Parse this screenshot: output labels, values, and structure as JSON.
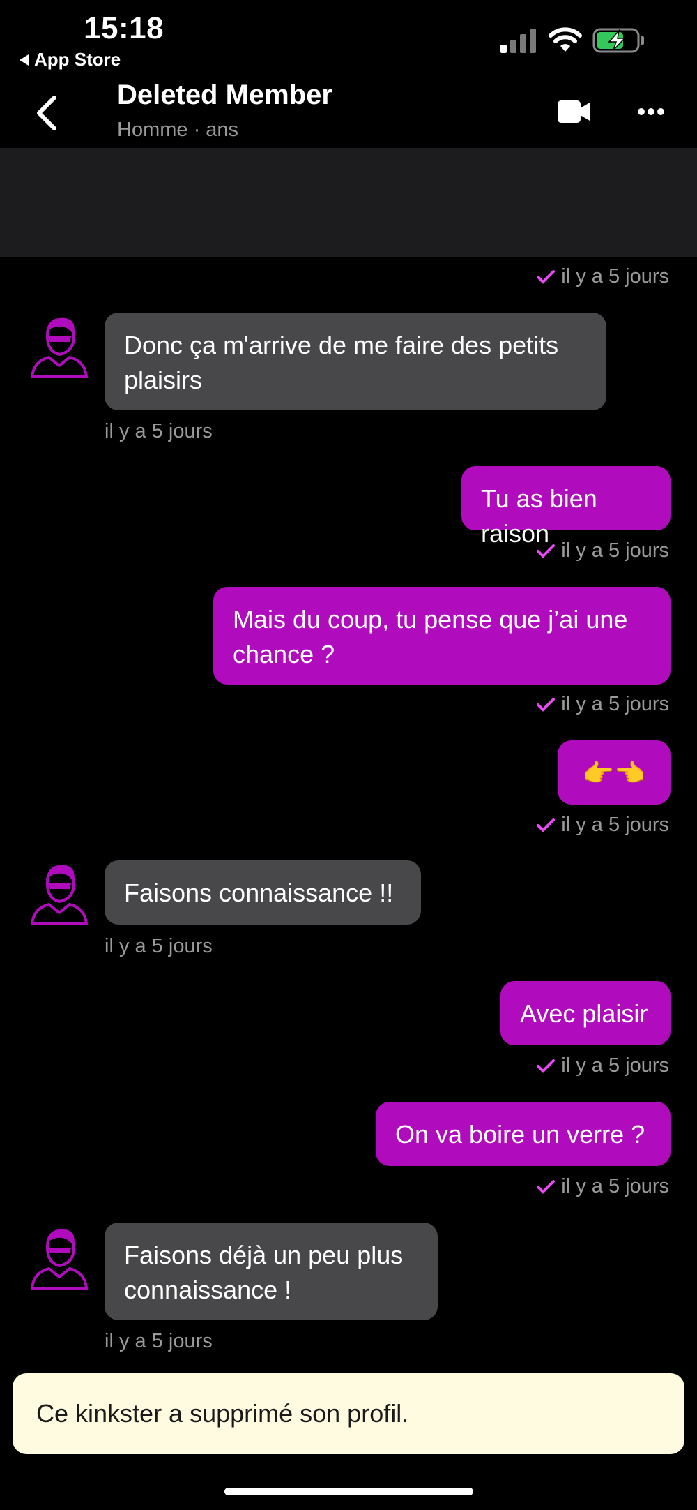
{
  "status_bar": {
    "time": "15:18",
    "back_app": "App Store"
  },
  "header": {
    "title": "Deleted Member",
    "subtitle": "Homme · ans"
  },
  "colors": {
    "outgoing_bubble": "#b00cbd",
    "incoming_bubble": "#48484a",
    "check": "#e64bf0",
    "notice_bg": "#fffbe0"
  },
  "messages": [
    {
      "dir": "out-timestamp-only",
      "time": "il y a 5 jours"
    },
    {
      "dir": "in",
      "text": "Donc ça m'arrive de me faire des petits plaisirs",
      "line1": "Donc ça m'arrive de me faire des petits",
      "line2": "plaisirs",
      "time": "il y a 5 jours"
    },
    {
      "dir": "out",
      "text": "Tu as bien raison",
      "time": "il y a 5 jours"
    },
    {
      "dir": "out",
      "line1": "Mais du coup, tu pense que j’ai une",
      "line2": "chance ?",
      "time": "il y a 5 jours"
    },
    {
      "dir": "out",
      "text": "👉👈",
      "time": "il y a 5 jours"
    },
    {
      "dir": "in",
      "text": "Faisons connaissance !!",
      "time": "il y a 5 jours"
    },
    {
      "dir": "out",
      "text": "Avec plaisir",
      "time": "il y a 5 jours"
    },
    {
      "dir": "out",
      "text": "On va boire un verre ?",
      "time": "il y a 5 jours"
    },
    {
      "dir": "in",
      "line1": "Faisons déjà un peu plus",
      "line2": "connaissance !",
      "time": "il y a 5 jours"
    }
  ],
  "notice": {
    "text": "Ce kinkster a supprimé son profil."
  },
  "icons": [
    "signal-icon",
    "wifi-icon",
    "battery-charging-icon",
    "back-chevron-icon",
    "video-call-icon",
    "more-options-icon",
    "avatar-icon",
    "check-icon"
  ]
}
